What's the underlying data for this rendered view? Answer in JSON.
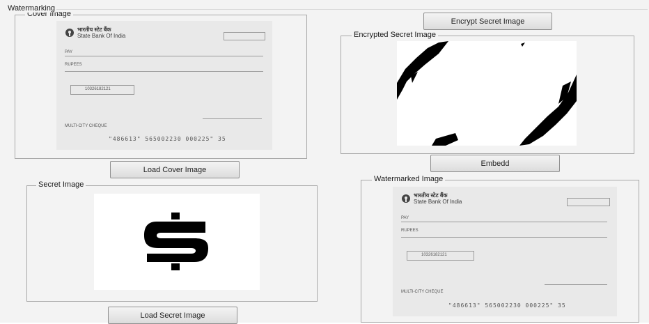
{
  "window": {
    "title": "Watermarking"
  },
  "panels": {
    "cover": {
      "title": "Cover Image"
    },
    "encrypted": {
      "title": "Encrypted Secret Image"
    },
    "secret": {
      "title": "Secret Image"
    },
    "watermarked": {
      "title": "Watermarked Image"
    }
  },
  "buttons": {
    "load_cover": "Load Cover Image",
    "encrypt": "Encrypt Secret  Image",
    "embed": "Embedd",
    "load_secret": "Load Secret  Image"
  },
  "cheque": {
    "bank_hindi": "भारतीय स्टेट बैंक",
    "bank_name": "State Bank Of India",
    "pay": "PAY",
    "rupees": "RUPEES",
    "account": "10326182121",
    "multicity": "MULTI-CITY CHEQUE",
    "micr": "\"486613\" 565002230 000225\" 35"
  },
  "secret_symbol": "$",
  "colors": {
    "panel_bg": "#f3f3f3",
    "border": "#a8a8a8",
    "button_top": "#f4f4f4",
    "button_bottom": "#dcdcdc"
  }
}
